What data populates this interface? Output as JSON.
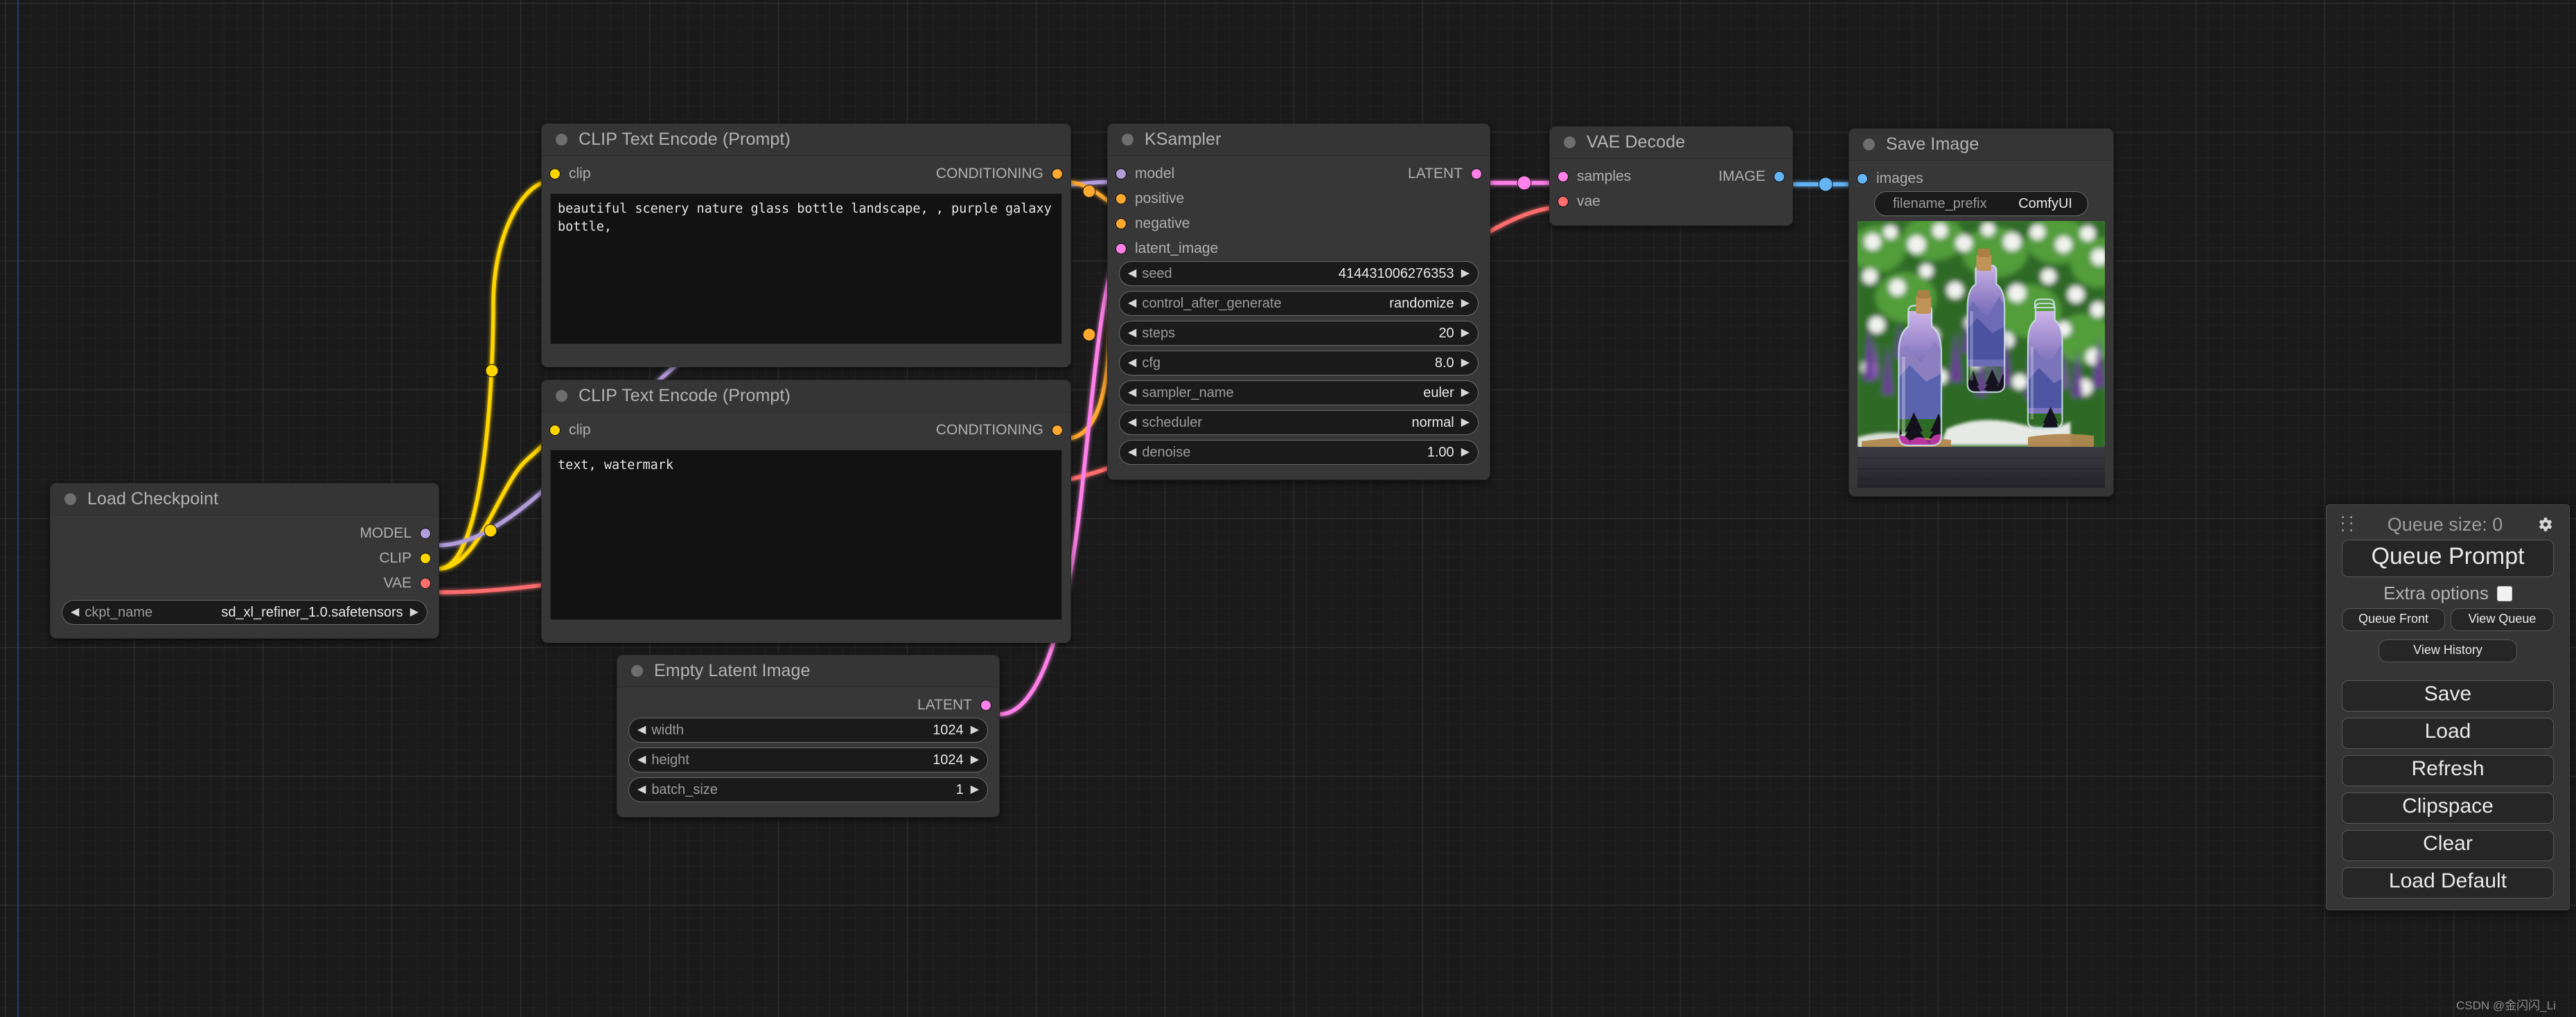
{
  "canvas": {
    "background": "#1a1a1a",
    "grid": true
  },
  "watermark": {
    "text": "CSDN @金闪闪_Li"
  },
  "colors": {
    "model": "#b39ddb",
    "clip": "#ffd500",
    "vae": "#ff6e6e",
    "conditioning": "#ffa931",
    "latent": "#ff80e8",
    "image": "#64b5f6",
    "node_header": "#353535",
    "node_body": "#373737",
    "widget": "#1a1a1a"
  },
  "nodes": {
    "load_checkpoint": {
      "title": "Load Checkpoint",
      "outputs": [
        {
          "label": "MODEL",
          "type": "model"
        },
        {
          "label": "CLIP",
          "type": "clip"
        },
        {
          "label": "VAE",
          "type": "vae"
        }
      ],
      "widgets": [
        {
          "name": "ckpt_name",
          "value": "sd_xl_refiner_1.0.safetensors"
        }
      ]
    },
    "clip_positive": {
      "title": "CLIP Text Encode (Prompt)",
      "inputs": [
        {
          "label": "clip",
          "type": "clip"
        }
      ],
      "outputs": [
        {
          "label": "CONDITIONING",
          "type": "conditioning"
        }
      ],
      "text": "beautiful scenery nature glass bottle landscape, , purple galaxy bottle,"
    },
    "clip_negative": {
      "title": "CLIP Text Encode (Prompt)",
      "inputs": [
        {
          "label": "clip",
          "type": "clip"
        }
      ],
      "outputs": [
        {
          "label": "CONDITIONING",
          "type": "conditioning"
        }
      ],
      "text": "text, watermark"
    },
    "empty_latent": {
      "title": "Empty Latent Image",
      "outputs": [
        {
          "label": "LATENT",
          "type": "latent"
        }
      ],
      "widgets": [
        {
          "name": "width",
          "value": "1024"
        },
        {
          "name": "height",
          "value": "1024"
        },
        {
          "name": "batch_size",
          "value": "1"
        }
      ]
    },
    "ksampler": {
      "title": "KSampler",
      "inputs": [
        {
          "label": "model",
          "type": "model"
        },
        {
          "label": "positive",
          "type": "conditioning"
        },
        {
          "label": "negative",
          "type": "conditioning"
        },
        {
          "label": "latent_image",
          "type": "latent"
        }
      ],
      "outputs": [
        {
          "label": "LATENT",
          "type": "latent"
        }
      ],
      "widgets": [
        {
          "name": "seed",
          "value": "414431006276353"
        },
        {
          "name": "control_after_generate",
          "value": "randomize"
        },
        {
          "name": "steps",
          "value": "20"
        },
        {
          "name": "cfg",
          "value": "8.0"
        },
        {
          "name": "sampler_name",
          "value": "euler"
        },
        {
          "name": "scheduler",
          "value": "normal"
        },
        {
          "name": "denoise",
          "value": "1.00"
        }
      ]
    },
    "vae_decode": {
      "title": "VAE Decode",
      "inputs": [
        {
          "label": "samples",
          "type": "latent"
        },
        {
          "label": "vae",
          "type": "vae"
        }
      ],
      "outputs": [
        {
          "label": "IMAGE",
          "type": "image"
        }
      ]
    },
    "save_image": {
      "title": "Save Image",
      "inputs": [
        {
          "label": "images",
          "type": "image"
        }
      ],
      "widgets": [
        {
          "name": "filename_prefix",
          "value": "ComfyUI"
        }
      ],
      "preview_alt": "three glass bottles containing purple mountain landscapes, lupine flowers behind"
    }
  },
  "menu": {
    "queue_size_label": "Queue size: 0",
    "gear_icon": "gear-icon",
    "drag_handle_icon": "drag-handle-icon",
    "queue_prompt_label": "Queue Prompt",
    "extra_options_label": "Extra options",
    "extra_options_checked": false,
    "queue_front_label": "Queue Front",
    "view_queue_label": "View Queue",
    "view_history_label": "View History",
    "save_label": "Save",
    "load_label": "Load",
    "refresh_label": "Refresh",
    "clipspace_label": "Clipspace",
    "clear_label": "Clear",
    "load_default_label": "Load Default"
  }
}
